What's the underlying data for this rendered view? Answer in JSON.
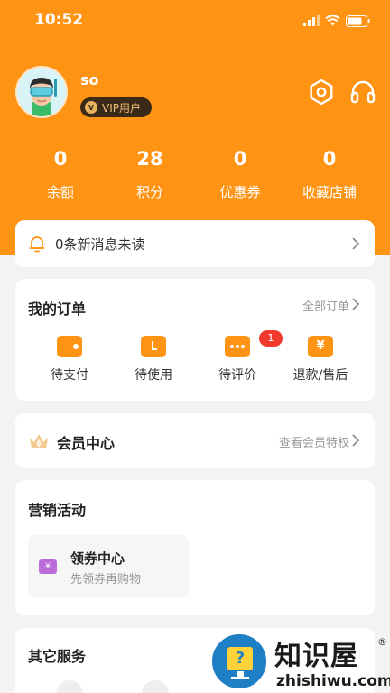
{
  "status_bar": {
    "time": "10:52"
  },
  "profile": {
    "username": "so",
    "vip_label": "VIP用户",
    "vip_mark": "V"
  },
  "stats": [
    {
      "value": "0",
      "label": "余额"
    },
    {
      "value": "28",
      "label": "积分"
    },
    {
      "value": "0",
      "label": "优惠券"
    },
    {
      "value": "0",
      "label": "收藏店铺"
    }
  ],
  "messages": {
    "text": "0条新消息未读"
  },
  "orders": {
    "title": "我的订单",
    "all_link": "全部订单",
    "items": [
      {
        "label": "待支付",
        "icon": "wallet-icon"
      },
      {
        "label": "待使用",
        "icon": "ticket-icon"
      },
      {
        "label": "待评价",
        "icon": "comment-icon",
        "badge": "1"
      },
      {
        "label": "退款/售后",
        "icon": "refund-icon",
        "glyph": "¥"
      }
    ]
  },
  "member": {
    "title": "会员中心",
    "link": "查看会员特权"
  },
  "marketing": {
    "title": "营销活动",
    "coupon": {
      "title": "领券中心",
      "subtitle": "先领券再购物",
      "glyph": "¥"
    }
  },
  "other": {
    "title": "其它服务"
  },
  "watermark": {
    "name": "知识屋",
    "url": "zhishiwu.com",
    "reg": "®",
    "glyph": "?"
  },
  "colors": {
    "brand_orange": "#ff9414",
    "badge_red": "#f03a2e",
    "vip_gold": "#f2c37a",
    "coupon_purple": "#b96dd8"
  }
}
